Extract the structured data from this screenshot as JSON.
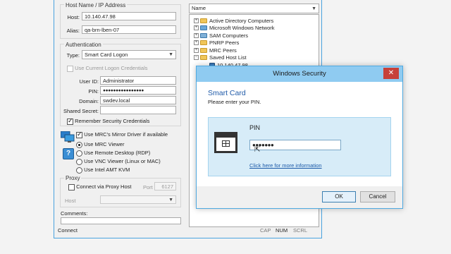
{
  "host": {
    "group_title": "Host Name / IP Address",
    "host_label": "Host:",
    "host_value": "10.140.47.98",
    "alias_label": "Alias:",
    "alias_value": "qa-brn-lben-07"
  },
  "tree": {
    "column_header": "Name",
    "items": [
      {
        "label": "Active Directory Computers"
      },
      {
        "label": "Microsoft Windows Network"
      },
      {
        "label": "SAM Computers"
      },
      {
        "label": "PNRP Peers"
      },
      {
        "label": "MRC Peers"
      },
      {
        "label": "Saved Host List"
      },
      {
        "label": "10.140.47.98"
      }
    ]
  },
  "auth": {
    "group_title": "Authentication",
    "type_label": "Type:",
    "type_value": "Smart Card Logon",
    "use_current_label": "Use Current Logon Credentials",
    "user_id_label": "User ID:",
    "user_id_value": "Administrator",
    "pin_label": "PIN:",
    "pin_value": "●●●●●●●●●●●●●●●●",
    "domain_label": "Domain:",
    "domain_value": "swdev.local",
    "shared_secret_label": "Shared Secret:",
    "shared_secret_value": "",
    "remember_label": "Remember Security Credentials"
  },
  "viewer": {
    "mirror_driver_label": "Use MRC's Mirror Driver if available",
    "options": [
      {
        "label": "Use MRC Viewer",
        "selected": true
      },
      {
        "label": "Use Remote Desktop (RDP)",
        "selected": false
      },
      {
        "label": "Use VNC Viewer (Linux or MAC)",
        "selected": false
      },
      {
        "label": "Use Intel AMT KVM",
        "selected": false
      }
    ]
  },
  "proxy": {
    "group_title": "Proxy",
    "connect_label": "Connect via Proxy Host",
    "port_label": "Port",
    "port_value": "6127",
    "host_label": "Host"
  },
  "comments": {
    "label": "Comments:"
  },
  "status_bar": {
    "text": "Connect",
    "cap": "CAP",
    "num": "NUM",
    "scrl": "SCRL"
  },
  "dialog": {
    "title": "Windows Security",
    "close_glyph": "✕",
    "heading": "Smart Card",
    "subtitle": "Please enter your PIN.",
    "pin_label": "PIN",
    "pin_value": "●●●●●●●",
    "link": "Click here for more information",
    "ok_label": "OK",
    "cancel_label": "Cancel"
  },
  "colors": {
    "dialog_title_bar": "#8fcbf1",
    "dialog_heading": "#1f5aa8",
    "close_button": "#c7413a",
    "pin_panel": "#d7ecf8"
  }
}
